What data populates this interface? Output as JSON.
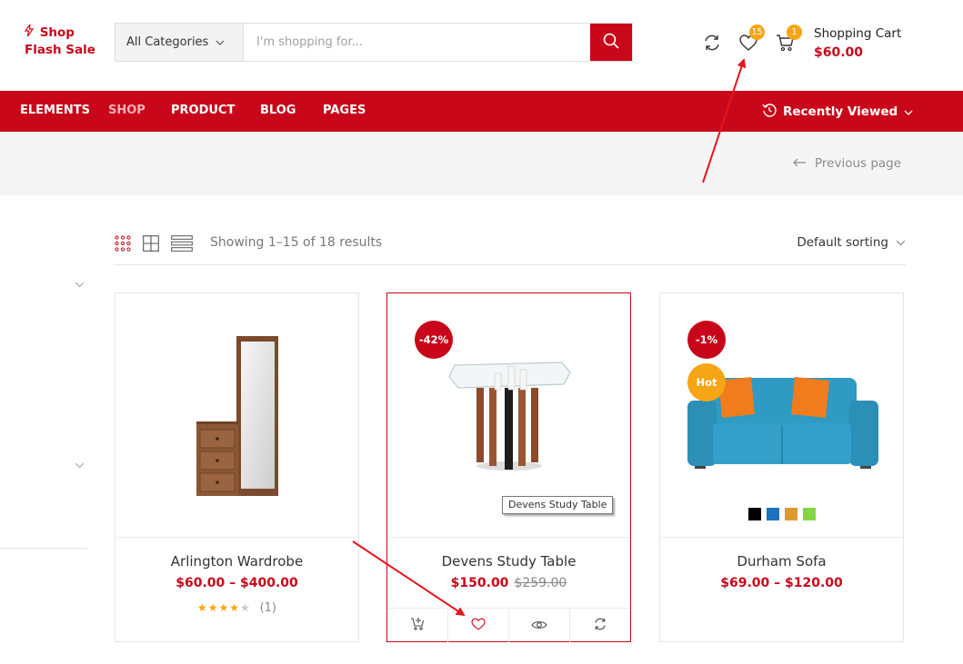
{
  "logo": {
    "line1": "Shop",
    "line2": "Flash Sale"
  },
  "search": {
    "category": "All Categories",
    "placeholder": "I'm shopping for..."
  },
  "header": {
    "wishlist_count": "15",
    "cart_count": "1",
    "cart_title": "Shopping Cart",
    "cart_total": "$60.00"
  },
  "nav": {
    "items": [
      "ELEMENTS",
      "SHOP",
      "PRODUCT",
      "BLOG",
      "PAGES"
    ],
    "recent": "Recently Viewed"
  },
  "breadcrumb": {
    "prev": "Previous page"
  },
  "toolbar": {
    "count": "Showing 1–15 of 18 results",
    "sorting": "Default sorting"
  },
  "products": [
    {
      "name": "Arlington Wardrobe",
      "price": "$60.00 – $400.00",
      "rating_count": "(1)",
      "stars": 4
    },
    {
      "name": "Devens Study Table",
      "price": "$150.00",
      "old_price": "$259.00",
      "badge": "-42%",
      "tooltip": "Devens Study Table"
    },
    {
      "name": "Durham Sofa",
      "price": "$69.00 – $120.00",
      "badge": "-1%",
      "hot": "Hot"
    }
  ],
  "colors": {
    "accent": "#c8081a",
    "badge_orange": "#f6a514"
  },
  "swatch_colors": [
    "#000000",
    "#1e73be",
    "#dd9933",
    "#81d742"
  ]
}
